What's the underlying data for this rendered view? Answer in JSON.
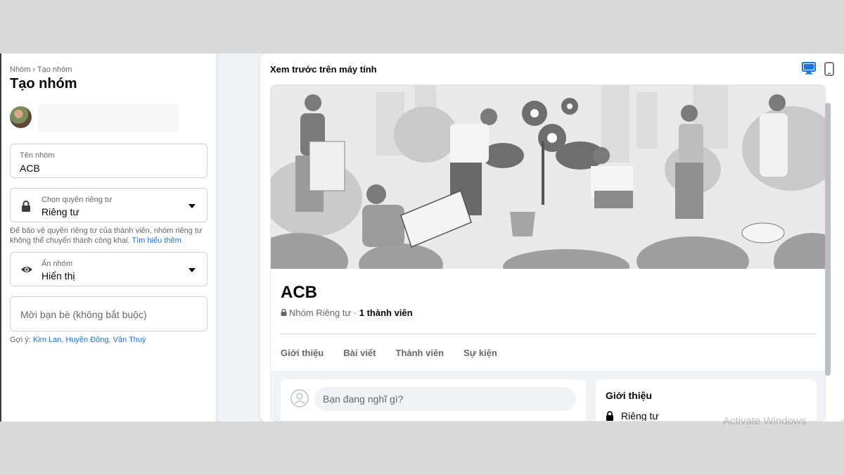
{
  "sidebar": {
    "breadcrumb": "Nhóm › Tạo nhóm",
    "title": "Tạo nhóm",
    "group_name_field": {
      "label": "Tên nhóm",
      "value": "ACB"
    },
    "privacy_field": {
      "label": "Chọn quyền riêng tư",
      "value": "Riêng tư",
      "icon": "lock-icon"
    },
    "privacy_note": "Để bảo vệ quyền riêng tư của thành viên, nhóm riêng tư không thể chuyển thành công khai.",
    "privacy_note_link": "Tìm hiểu thêm",
    "visibility_field": {
      "label": "Ẩn nhóm",
      "value": "Hiển thị",
      "icon": "eye-icon"
    },
    "invite_field": {
      "placeholder": "Mời bạn bè (không bắt buộc)"
    },
    "suggestion_prefix": "Gợi ý:",
    "suggestions": [
      "Kim Lan",
      "Huyền Đông",
      "Vân Thuỳ"
    ]
  },
  "preview": {
    "title": "Xem trước trên máy tính",
    "group_name": "ACB",
    "group_privacy": "Nhóm Riêng tư",
    "member_count": "1 thành viên",
    "tabs": [
      "Giới thiệu",
      "Bài viết",
      "Thành viên",
      "Sự kiện"
    ],
    "composer_placeholder": "Bạn đang nghĩ gì?",
    "about_title": "Giới thiệu",
    "about_privacy": "Riêng tư"
  },
  "watermark": "Activate Windows",
  "colors": {
    "link": "#1b74e4",
    "background": "#f0f2f5"
  }
}
